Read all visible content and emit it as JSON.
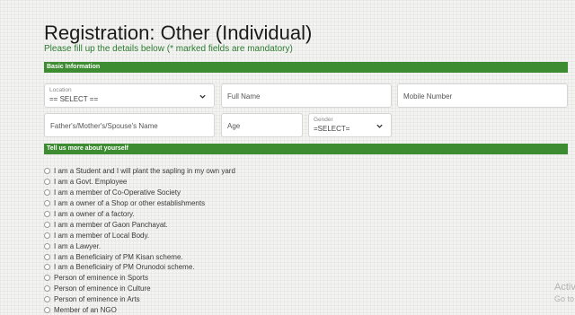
{
  "page": {
    "title": "Registration: Other (Individual)",
    "subtitle": "Please fill up the details below (* marked fields are mandatory)"
  },
  "sections": {
    "basic": "Basic Information",
    "about": "Tell us more about yourself"
  },
  "fields": {
    "location_label": "Location",
    "location_value": "== SELECT ==",
    "fullname_placeholder": "Full Name",
    "mobile_placeholder": "Mobile Number",
    "guardian_placeholder": "Father's/Mother's/Spouse's Name",
    "age_placeholder": "Age",
    "gender_label": "Gender",
    "gender_value": "=SELECT="
  },
  "options": [
    "I am a Student and I will plant the sapling in my own yard",
    "I am a Govt. Employee",
    "I am a member of Co-Operative Society",
    "I am a owner of a Shop or other establishments",
    "I am a owner of a factory.",
    "I am a member of Gaon Panchayat.",
    "I am a member of Local Body.",
    "I am a Lawyer.",
    "I am a Beneficiairy of PM Kisan scheme.",
    "I am a Beneficiairy of PM Orunodoi scheme.",
    "Person of eminence in Sports",
    "Person of eminence in Culture",
    "Person of eminence in Arts",
    "Member of an NGO"
  ],
  "watermark": {
    "line1": "Activ",
    "line2": "Go to"
  },
  "icons": {
    "select_arrow": "chevron-down-icon",
    "option": "radio-icon"
  },
  "colors": {
    "accent": "#3d8c32",
    "subtitle": "#2e7d32"
  }
}
